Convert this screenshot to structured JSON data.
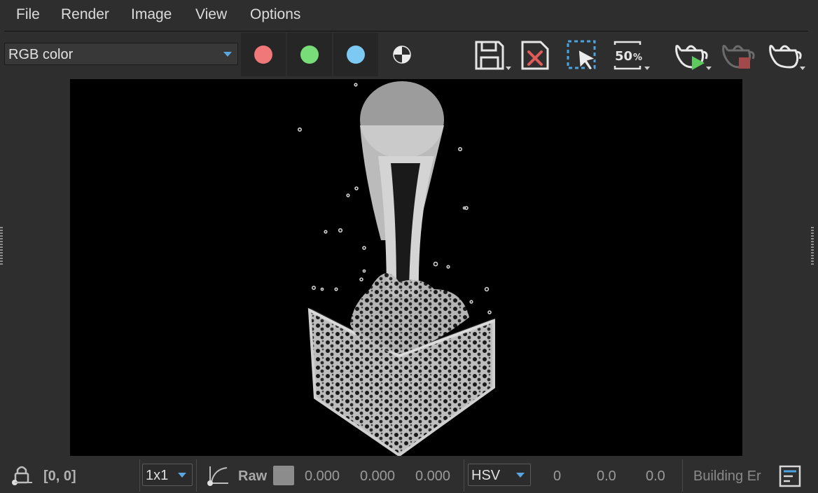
{
  "menu": {
    "file": "File",
    "render": "Render",
    "image": "Image",
    "view": "View",
    "options": "Options"
  },
  "toolbar": {
    "channel": "RGB color",
    "channels": [
      {
        "name": "red",
        "color": "#f07878"
      },
      {
        "name": "green",
        "color": "#78dc78"
      },
      {
        "name": "blue",
        "color": "#7ccaf4"
      }
    ],
    "region_zoom": "50"
  },
  "status": {
    "coords": "[0, 0]",
    "sampling": "1x1",
    "raw_label": "Raw",
    "swatch_color": "#8c8c8c",
    "rgb_values": [
      "0.000",
      "0.000",
      "0.000"
    ],
    "color_space": "HSV",
    "hsv_values": [
      "0",
      "0.0",
      "0.0"
    ],
    "message": "Building Er"
  }
}
